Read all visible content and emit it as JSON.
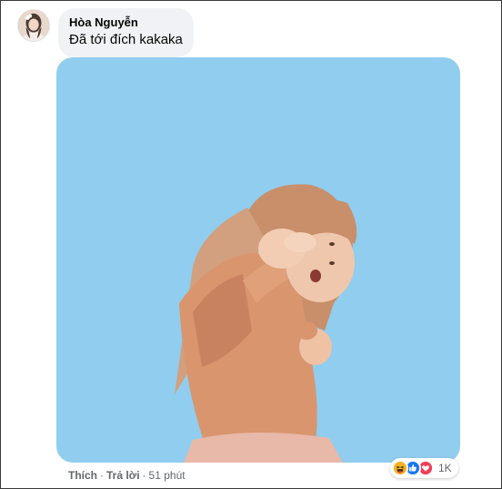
{
  "comment": {
    "author": "Hòa Nguyễn",
    "text": "Đã tới đích kakaka"
  },
  "actions": {
    "like": "Thích",
    "reply": "Trả lời",
    "separator": "·",
    "time": "51 phút"
  },
  "reactions": {
    "icons": [
      "haha-icon",
      "like-icon",
      "love-icon"
    ],
    "count": "1K"
  },
  "media": {
    "type": "gif",
    "background_color": "#91cdee"
  },
  "colors": {
    "bubble": "#f0f2f5",
    "secondary_text": "#65676b",
    "like_blue": "#1877f2",
    "love_red": "#f33e58",
    "haha_yellow": "#f7b125"
  }
}
